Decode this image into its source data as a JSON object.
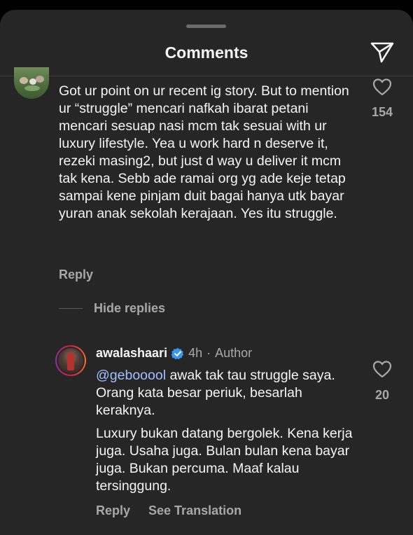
{
  "header": {
    "title": "Comments"
  },
  "comment": {
    "text": "Got ur point on ur recent ig story. But to mention ur “struggle” mencari nafkah ibarat petani mencari sesuap nasi mcm tak sesuai with ur luxury lifestyle. Yea u work hard n deserve it, rezeki masing2, but just d way u deliver it mcm tak kena. Sebb ade ramai org yg ade keje tetap sampai kene pinjam duit bagai hanya utk bayar yuran anak sekolah kerajaan. Yes itu struggle.",
    "likes": "154",
    "reply_label": "Reply",
    "hide_replies_label": "Hide replies"
  },
  "reply": {
    "username": "awalashaari",
    "time": "4h",
    "separator": "·",
    "author_badge": "Author",
    "mention": "@gebooool",
    "text1_rest": " awak tak tau struggle saya. Orang kata besar periuk, besarlah keraknya.",
    "text2": "Luxury bukan datang bergolek. Kena kerja juga. Usaha juga. Bulan bulan kena bayar juga. Bukan percuma. Maaf kalau tersinggung.",
    "likes": "20",
    "reply_label": "Reply",
    "translation_label": "See Translation"
  },
  "colors": {
    "background": "#262626",
    "muted": "#a8a8a8",
    "mention": "#9fc0ff",
    "verified": "#3897f0"
  },
  "icons": {
    "share": "paper-plane-icon",
    "like": "heart-outline-icon",
    "verified": "verified-badge-icon"
  }
}
